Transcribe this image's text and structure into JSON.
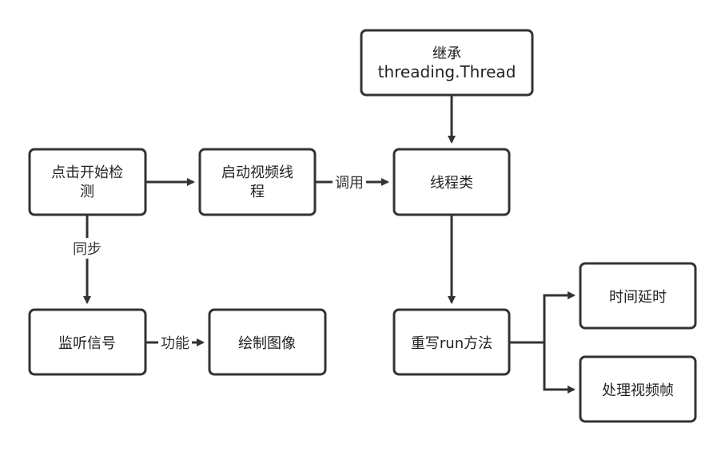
{
  "nodes": {
    "inherit": {
      "line1": "继承",
      "line2": "threading.Thread"
    },
    "start_detect": {
      "line1": "点击开始检",
      "line2": "测"
    },
    "start_video_thread": {
      "line1": "启动视频线",
      "line2": "程"
    },
    "thread_class": {
      "label": "线程类"
    },
    "listen_signal": {
      "label": "监听信号"
    },
    "draw_image": {
      "label": "绘制图像"
    },
    "override_run": {
      "label": "重写run方法"
    },
    "time_delay": {
      "label": "时间延时"
    },
    "process_frame": {
      "label": "处理视频帧"
    }
  },
  "edges": {
    "call": "调用",
    "sync": "同步",
    "function": "功能"
  },
  "colors": {
    "stroke": "#333333",
    "background": "#ffffff",
    "text": "#222222"
  }
}
